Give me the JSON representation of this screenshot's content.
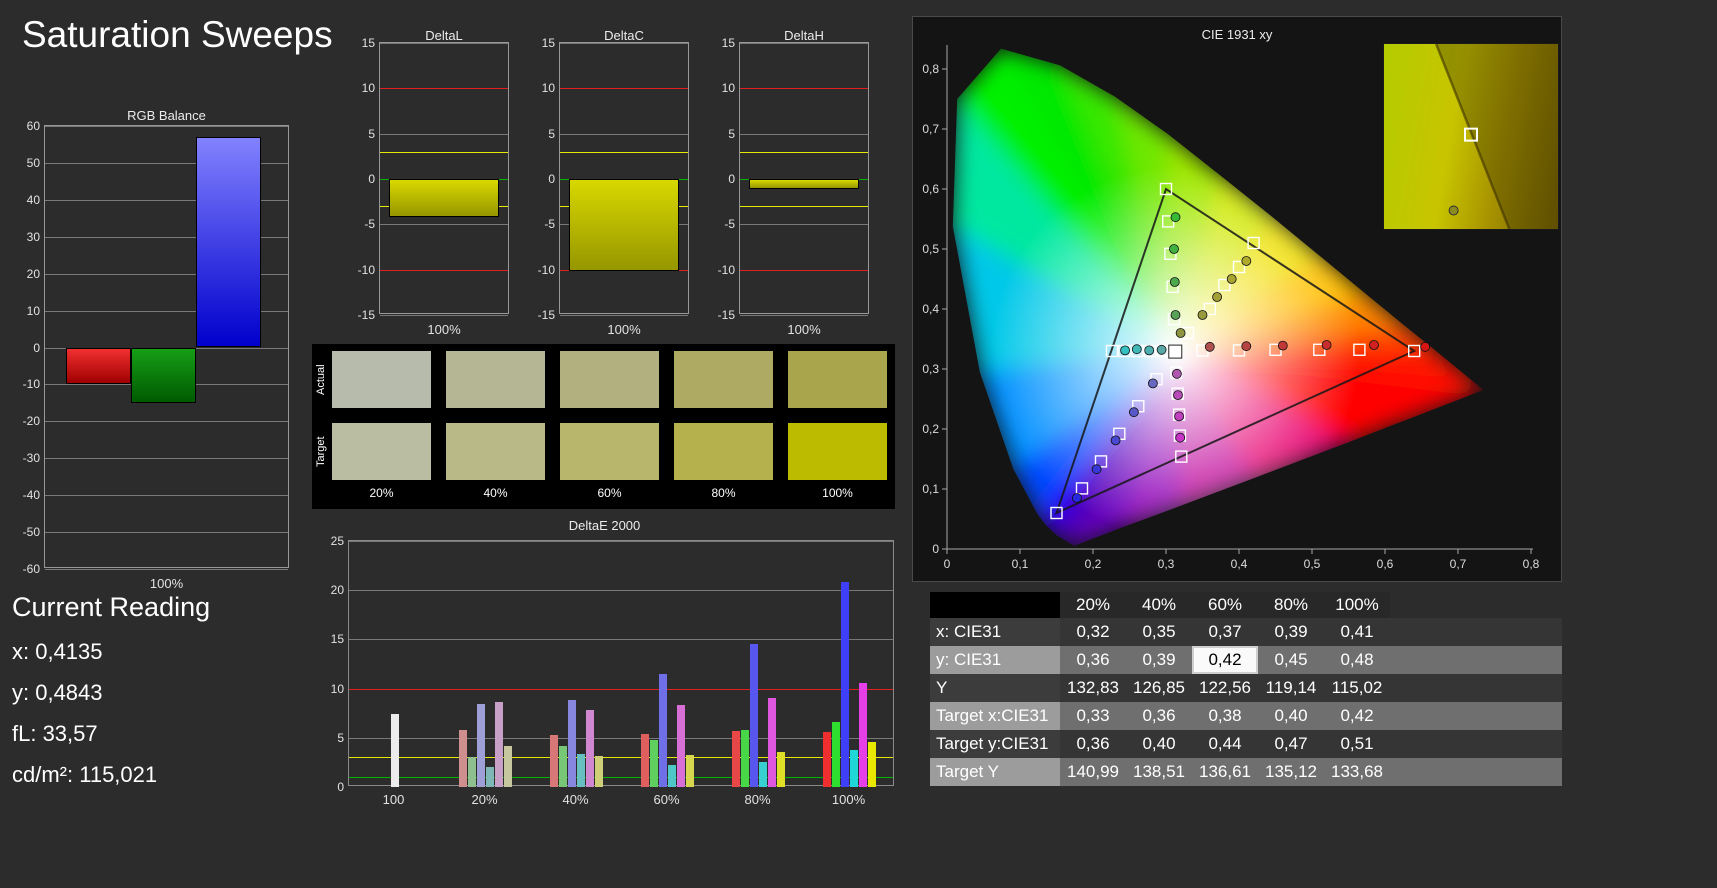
{
  "page": {
    "title": "Saturation Sweeps"
  },
  "current_reading": {
    "heading": "Current Reading",
    "lines": [
      "x: 0,4135",
      "y: 0,4843",
      "fL: 33,57",
      "cd/m²: 115,021"
    ]
  },
  "swatches": {
    "row_labels": [
      "Actual",
      "Target"
    ],
    "col_labels": [
      "20%",
      "40%",
      "60%",
      "80%",
      "100%"
    ],
    "actual_colors": [
      "#b6bbab",
      "#b4b694",
      "#b2b07e",
      "#aeaa64",
      "#a8a54c"
    ],
    "target_colors": [
      "#babda2",
      "#b9b988",
      "#b7b66c",
      "#b5b24e",
      "#bdbb00"
    ]
  },
  "table": {
    "col_headers": [
      "20%",
      "40%",
      "60%",
      "80%",
      "100%"
    ],
    "rows": [
      {
        "label": "x: CIE31",
        "values": [
          "0,32",
          "0,35",
          "0,37",
          "0,39",
          "0,41"
        ]
      },
      {
        "label": "y: CIE31",
        "values": [
          "0,36",
          "0,39",
          "0,42",
          "0,45",
          "0,48"
        ]
      },
      {
        "label": "Y",
        "values": [
          "132,83",
          "126,85",
          "122,56",
          "119,14",
          "115,02"
        ]
      },
      {
        "label": "Target x:CIE31",
        "values": [
          "0,33",
          "0,36",
          "0,38",
          "0,40",
          "0,42"
        ]
      },
      {
        "label": "Target y:CIE31",
        "values": [
          "0,36",
          "0,40",
          "0,44",
          "0,47",
          "0,51"
        ]
      },
      {
        "label": "Target Y",
        "values": [
          "140,99",
          "138,51",
          "136,61",
          "135,12",
          "133,68"
        ]
      }
    ],
    "highlight": {
      "row": 1,
      "col": 2
    }
  },
  "chart_data": [
    {
      "id": "rgb_balance",
      "type": "bar",
      "title": "RGB Balance",
      "categories": [
        "Red",
        "Green",
        "Blue"
      ],
      "values": [
        -10,
        -15,
        57
      ],
      "ylim": [
        -60,
        60
      ],
      "ytick_step": 10,
      "xlabel": "100%"
    },
    {
      "id": "delta_l",
      "type": "bar",
      "title": "DeltaL",
      "categories": [
        "100%"
      ],
      "values": [
        -4.2
      ],
      "ylim": [
        -15,
        15
      ],
      "xlabel": "100%",
      "ref_lines": [
        {
          "v": 10,
          "color": "#e02020"
        },
        {
          "v": -10,
          "color": "#e02020"
        },
        {
          "v": 3,
          "color": "#e8e800"
        },
        {
          "v": -3,
          "color": "#e8e800"
        },
        {
          "v": 0,
          "color": "#00b400"
        }
      ]
    },
    {
      "id": "delta_c",
      "type": "bar",
      "title": "DeltaC",
      "categories": [
        "100%"
      ],
      "values": [
        -10.1
      ],
      "ylim": [
        -15,
        15
      ],
      "xlabel": "100%",
      "ref_lines": [
        {
          "v": 10,
          "color": "#e02020"
        },
        {
          "v": -10,
          "color": "#e02020"
        },
        {
          "v": 3,
          "color": "#e8e800"
        },
        {
          "v": -3,
          "color": "#e8e800"
        },
        {
          "v": 0,
          "color": "#00b400"
        }
      ]
    },
    {
      "id": "delta_h",
      "type": "bar",
      "title": "DeltaH",
      "categories": [
        "100%"
      ],
      "values": [
        -1.1
      ],
      "ylim": [
        -15,
        15
      ],
      "xlabel": "100%",
      "ref_lines": [
        {
          "v": 10,
          "color": "#e02020"
        },
        {
          "v": -10,
          "color": "#e02020"
        },
        {
          "v": 3,
          "color": "#e8e800"
        },
        {
          "v": -3,
          "color": "#e8e800"
        },
        {
          "v": 0,
          "color": "#00b400"
        }
      ]
    },
    {
      "id": "delta_e_2000",
      "type": "grouped-bar",
      "title": "DeltaE 2000",
      "ylim": [
        0,
        25
      ],
      "yticks": [
        0,
        5,
        10,
        15,
        20,
        25
      ],
      "ref_lines": [
        {
          "v": 10,
          "color": "#e02020"
        },
        {
          "v": 3,
          "color": "#e8e800"
        },
        {
          "v": 1,
          "color": "#00b400"
        }
      ],
      "groups": [
        {
          "label": "100",
          "values": [
            7.4
          ],
          "colors": [
            "#ececec"
          ]
        },
        {
          "label": "20%",
          "values": [
            5.8,
            3.0,
            8.4,
            2.0,
            8.6,
            4.2
          ],
          "colors": [
            "#cf8f8f",
            "#8fbf8f",
            "#9f9fd7",
            "#7fb7b7",
            "#c79fc7",
            "#c7c79f"
          ]
        },
        {
          "label": "40%",
          "values": [
            5.3,
            4.2,
            8.8,
            3.4,
            7.8,
            3.2
          ],
          "colors": [
            "#d77777",
            "#77c777",
            "#8787df",
            "#67bfbf",
            "#cf87cf",
            "#cfcf77"
          ]
        },
        {
          "label": "60%",
          "values": [
            5.4,
            4.8,
            11.5,
            2.2,
            8.3,
            3.3
          ],
          "colors": [
            "#df5f5f",
            "#5fcf5f",
            "#6f6fe7",
            "#4fc7c7",
            "#d76fd7",
            "#d7d74f"
          ]
        },
        {
          "label": "80%",
          "values": [
            5.7,
            5.8,
            14.5,
            2.5,
            9.0,
            3.6
          ],
          "colors": [
            "#e74747",
            "#47d747",
            "#5757ef",
            "#37cfcf",
            "#df57df",
            "#dfdf27"
          ]
        },
        {
          "label": "100%",
          "values": [
            5.6,
            6.6,
            20.8,
            3.8,
            10.6,
            4.6
          ],
          "colors": [
            "#ef2f2f",
            "#2fdf2f",
            "#3f3ff7",
            "#1fd7d7",
            "#e73fe7",
            "#e7e700"
          ]
        }
      ]
    },
    {
      "id": "cie_1931",
      "type": "scatter",
      "title": "CIE 1931 xy",
      "xlim": [
        0,
        0.8
      ],
      "ylim": [
        0,
        0.8
      ],
      "xticks": [
        "0",
        "0,1",
        "0,2",
        "0,3",
        "0,4",
        "0,5",
        "0,6",
        "0,7",
        "0,8"
      ],
      "yticks": [
        "0",
        "0,1",
        "0,2",
        "0,3",
        "0,4",
        "0,5",
        "0,6",
        "0,7",
        "0,8"
      ],
      "white_point": [
        0.3127,
        0.329
      ],
      "targets": [
        [
          0.33,
          0.36
        ],
        [
          0.36,
          0.4
        ],
        [
          0.38,
          0.44
        ],
        [
          0.4,
          0.47
        ],
        [
          0.42,
          0.51
        ],
        [
          0.35,
          0.331
        ],
        [
          0.4,
          0.331
        ],
        [
          0.45,
          0.332
        ],
        [
          0.51,
          0.332
        ],
        [
          0.565,
          0.332
        ],
        [
          0.64,
          0.33
        ],
        [
          0.311,
          0.383
        ],
        [
          0.309,
          0.437
        ],
        [
          0.306,
          0.492
        ],
        [
          0.303,
          0.546
        ],
        [
          0.3,
          0.6
        ],
        [
          0.287,
          0.283
        ],
        [
          0.262,
          0.238
        ],
        [
          0.236,
          0.192
        ],
        [
          0.211,
          0.146
        ],
        [
          0.185,
          0.101
        ],
        [
          0.15,
          0.06
        ],
        [
          0.296,
          0.33
        ],
        [
          0.278,
          0.33
        ],
        [
          0.261,
          0.33
        ],
        [
          0.243,
          0.33
        ],
        [
          0.226,
          0.33
        ],
        [
          0.314,
          0.294
        ],
        [
          0.316,
          0.259
        ],
        [
          0.318,
          0.224
        ],
        [
          0.319,
          0.189
        ],
        [
          0.321,
          0.154
        ]
      ],
      "measured": [
        [
          0.32,
          0.36,
          "#8f9440"
        ],
        [
          0.35,
          0.39,
          "#999a3c"
        ],
        [
          0.37,
          0.42,
          "#a3a037"
        ],
        [
          0.39,
          0.45,
          "#aaa532"
        ],
        [
          0.41,
          0.48,
          "#b1ab2d"
        ],
        [
          0.36,
          0.337,
          "#b05050"
        ],
        [
          0.41,
          0.338,
          "#b84444"
        ],
        [
          0.46,
          0.339,
          "#c03838"
        ],
        [
          0.52,
          0.34,
          "#c82c2c"
        ],
        [
          0.585,
          0.34,
          "#d02020"
        ],
        [
          0.655,
          0.337,
          "#d81414"
        ],
        [
          0.313,
          0.39,
          "#57a257"
        ],
        [
          0.312,
          0.445,
          "#4caa4c"
        ],
        [
          0.311,
          0.5,
          "#41b241"
        ],
        [
          0.313,
          0.553,
          "#36ba36"
        ],
        [
          0.282,
          0.276,
          "#6868c0"
        ],
        [
          0.256,
          0.228,
          "#5858c8"
        ],
        [
          0.231,
          0.181,
          "#4848d0"
        ],
        [
          0.205,
          0.133,
          "#3838d8"
        ],
        [
          0.178,
          0.085,
          "#2828e0"
        ],
        [
          0.294,
          0.332,
          "#58a8a8"
        ],
        [
          0.277,
          0.331,
          "#4cb0b0"
        ],
        [
          0.26,
          0.333,
          "#40b8b8"
        ],
        [
          0.244,
          0.331,
          "#34c0c0"
        ],
        [
          0.315,
          0.292,
          "#b058b0"
        ],
        [
          0.3165,
          0.2565,
          "#b84cb8"
        ],
        [
          0.318,
          0.221,
          "#c040c0"
        ],
        [
          0.3195,
          0.1855,
          "#c834c8"
        ]
      ],
      "inset": {
        "square": {
          "x": 0.5,
          "y": 0.49
        },
        "dot": {
          "x": 0.4,
          "y": 0.9
        }
      }
    }
  ]
}
